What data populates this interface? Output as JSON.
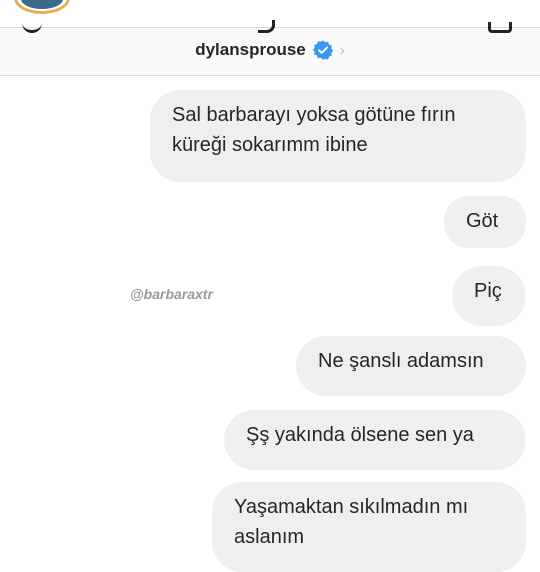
{
  "header": {
    "username": "dylansprouse",
    "verified_icon": "verified-badge-icon",
    "chevron": "›"
  },
  "watermark": "@barbaraxtr",
  "messages": [
    {
      "lines": [
        "Sal barbarayı yoksa götüne fırın",
        "küreği sokarımm ibine"
      ]
    },
    {
      "lines": [
        "Göt"
      ]
    },
    {
      "lines": [
        "Piç"
      ]
    },
    {
      "lines": [
        "Ne şanslı adamsın"
      ]
    },
    {
      "lines": [
        "Şş yakında ölsene sen ya"
      ]
    },
    {
      "lines": [
        "Yaşamaktan sıkılmadın mı",
        "aslanım"
      ]
    }
  ],
  "colors": {
    "bubble": "#efefef",
    "text": "#262626",
    "verified": "#3897f0",
    "avatar_ring": "#e0b04a"
  }
}
